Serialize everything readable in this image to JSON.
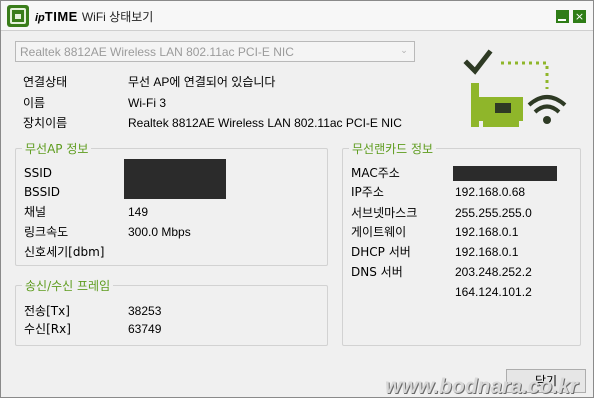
{
  "titlebar": {
    "brand_ip": "ip",
    "brand_time": "TIME",
    "title": "WiFi 상태보기",
    "minimize_glyph": "_",
    "close_glyph": "×"
  },
  "adapter_select": {
    "selected": "Realtek 8812AE Wireless LAN 802.11ac PCI-E NIC",
    "arrow": "⌄"
  },
  "connection": {
    "status_label": "연결상태",
    "status_value": "무선 AP에 연결되어 있습니다",
    "name_label": "이름",
    "name_value": "Wi-Fi 3",
    "device_label": "장치이름",
    "device_value": "Realtek 8812AE Wireless LAN 802.11ac PCI-E NIC"
  },
  "wireless_ap": {
    "title": "무선AP 정보",
    "ssid_label": "SSID",
    "bssid_label": "BSSID",
    "channel_label": "채널",
    "channel_value": "149",
    "link_speed_label": "링크속도",
    "link_speed_value": "300.0 Mbps",
    "signal_label": "신호세기[dbm]"
  },
  "frames": {
    "title": "송신/수신 프레임",
    "tx_label": "전송[Tx]",
    "tx_value": "38253",
    "rx_label": "수신[Rx]",
    "rx_value": "63749"
  },
  "lan_card": {
    "title": "무선랜카드 정보",
    "mac_label": "MAC주소",
    "ip_label": "IP주소",
    "ip_value": "192.168.0.68",
    "subnet_label": "서브넷마스크",
    "subnet_value": "255.255.255.0",
    "gateway_label": "게이트웨이",
    "gateway_value": "192.168.0.1",
    "dhcp_label": "DHCP 서버",
    "dhcp_value": "192.168.0.1",
    "dns_label": "DNS 서버",
    "dns_value_1": "203.248.252.2",
    "dns_value_2": "164.124.101.2"
  },
  "footer": {
    "close_label": "닫기",
    "watermark": "www.bodnara.co.kr"
  },
  "colors": {
    "accent_green": "#5e9c1e",
    "brand_green": "#2f7d17",
    "illustration_green": "#8fb62a",
    "redaction": "#2b2b2b"
  },
  "icons": {
    "app": "iptime-logo-icon",
    "illustration": "wifi-card-connected-icon"
  }
}
